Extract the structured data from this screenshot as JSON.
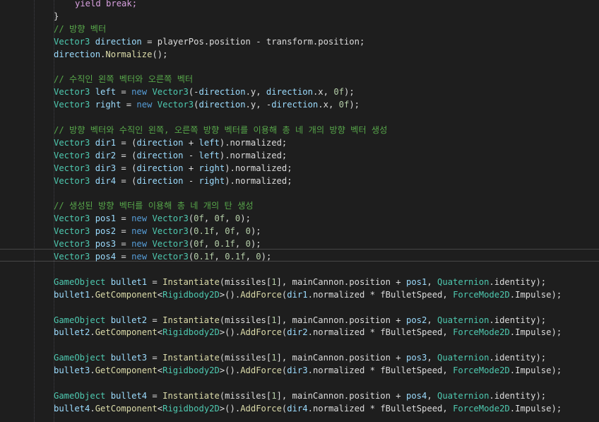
{
  "code_lines": [
    [
      {
        "t": "yield break;",
        "c": "ctl"
      }
    ],
    [
      {
        "t": "}",
        "c": "pl"
      }
    ],
    [
      {
        "t": "// 방향 벡터",
        "c": "cm"
      }
    ],
    [
      {
        "t": "Vector3",
        "c": "ty"
      },
      {
        "t": " ",
        "c": "pl"
      },
      {
        "t": "direction",
        "c": "lv"
      },
      {
        "t": " = playerPos.position - transform.position;",
        "c": "pl"
      }
    ],
    [
      {
        "t": "direction",
        "c": "lv"
      },
      {
        "t": ".",
        "c": "pl"
      },
      {
        "t": "Normalize",
        "c": "fn"
      },
      {
        "t": "();",
        "c": "pl"
      }
    ],
    [],
    [
      {
        "t": "// 수직인 왼쪽 벡터와 오른쪽 벡터",
        "c": "cm"
      }
    ],
    [
      {
        "t": "Vector3",
        "c": "ty"
      },
      {
        "t": " ",
        "c": "pl"
      },
      {
        "t": "left",
        "c": "lv"
      },
      {
        "t": " = ",
        "c": "pl"
      },
      {
        "t": "new",
        "c": "kw"
      },
      {
        "t": " ",
        "c": "pl"
      },
      {
        "t": "Vector3",
        "c": "ty"
      },
      {
        "t": "(-",
        "c": "pl"
      },
      {
        "t": "direction",
        "c": "lv"
      },
      {
        "t": ".y, ",
        "c": "pl"
      },
      {
        "t": "direction",
        "c": "lv"
      },
      {
        "t": ".x, ",
        "c": "pl"
      },
      {
        "t": "0f",
        "c": "num"
      },
      {
        "t": ");",
        "c": "pl"
      }
    ],
    [
      {
        "t": "Vector3",
        "c": "ty"
      },
      {
        "t": " ",
        "c": "pl"
      },
      {
        "t": "right",
        "c": "lv"
      },
      {
        "t": " = ",
        "c": "pl"
      },
      {
        "t": "new",
        "c": "kw"
      },
      {
        "t": " ",
        "c": "pl"
      },
      {
        "t": "Vector3",
        "c": "ty"
      },
      {
        "t": "(",
        "c": "pl"
      },
      {
        "t": "direction",
        "c": "lv"
      },
      {
        "t": ".y, -",
        "c": "pl"
      },
      {
        "t": "direction",
        "c": "lv"
      },
      {
        "t": ".x, ",
        "c": "pl"
      },
      {
        "t": "0f",
        "c": "num"
      },
      {
        "t": ");",
        "c": "pl"
      }
    ],
    [],
    [
      {
        "t": "// 방향 벡터와 수직인 왼쪽, 오른쪽 방향 벡터를 이용해 총 네 개의 방향 벡터 생성",
        "c": "cm"
      }
    ],
    [
      {
        "t": "Vector3",
        "c": "ty"
      },
      {
        "t": " ",
        "c": "pl"
      },
      {
        "t": "dir1",
        "c": "lv"
      },
      {
        "t": " = (",
        "c": "pl"
      },
      {
        "t": "direction",
        "c": "lv"
      },
      {
        "t": " + ",
        "c": "pl"
      },
      {
        "t": "left",
        "c": "lv"
      },
      {
        "t": ").normalized;",
        "c": "pl"
      }
    ],
    [
      {
        "t": "Vector3",
        "c": "ty"
      },
      {
        "t": " ",
        "c": "pl"
      },
      {
        "t": "dir2",
        "c": "lv"
      },
      {
        "t": " = (",
        "c": "pl"
      },
      {
        "t": "direction",
        "c": "lv"
      },
      {
        "t": " - ",
        "c": "pl"
      },
      {
        "t": "left",
        "c": "lv"
      },
      {
        "t": ").normalized;",
        "c": "pl"
      }
    ],
    [
      {
        "t": "Vector3",
        "c": "ty"
      },
      {
        "t": " ",
        "c": "pl"
      },
      {
        "t": "dir3",
        "c": "lv"
      },
      {
        "t": " = (",
        "c": "pl"
      },
      {
        "t": "direction",
        "c": "lv"
      },
      {
        "t": " + ",
        "c": "pl"
      },
      {
        "t": "right",
        "c": "lv"
      },
      {
        "t": ").normalized;",
        "c": "pl"
      }
    ],
    [
      {
        "t": "Vector3",
        "c": "ty"
      },
      {
        "t": " ",
        "c": "pl"
      },
      {
        "t": "dir4",
        "c": "lv"
      },
      {
        "t": " = (",
        "c": "pl"
      },
      {
        "t": "direction",
        "c": "lv"
      },
      {
        "t": " - ",
        "c": "pl"
      },
      {
        "t": "right",
        "c": "lv"
      },
      {
        "t": ").normalized;",
        "c": "pl"
      }
    ],
    [],
    [
      {
        "t": "// 생성된 방향 벡터를 이용해 총 네 개의 탄 생성",
        "c": "cm"
      }
    ],
    [
      {
        "t": "Vector3",
        "c": "ty"
      },
      {
        "t": " ",
        "c": "pl"
      },
      {
        "t": "pos1",
        "c": "lv"
      },
      {
        "t": " = ",
        "c": "pl"
      },
      {
        "t": "new",
        "c": "kw"
      },
      {
        "t": " ",
        "c": "pl"
      },
      {
        "t": "Vector3",
        "c": "ty"
      },
      {
        "t": "(",
        "c": "pl"
      },
      {
        "t": "0f",
        "c": "num"
      },
      {
        "t": ", ",
        "c": "pl"
      },
      {
        "t": "0f",
        "c": "num"
      },
      {
        "t": ", ",
        "c": "pl"
      },
      {
        "t": "0",
        "c": "num"
      },
      {
        "t": ");",
        "c": "pl"
      }
    ],
    [
      {
        "t": "Vector3",
        "c": "ty"
      },
      {
        "t": " ",
        "c": "pl"
      },
      {
        "t": "pos2",
        "c": "lv"
      },
      {
        "t": " = ",
        "c": "pl"
      },
      {
        "t": "new",
        "c": "kw"
      },
      {
        "t": " ",
        "c": "pl"
      },
      {
        "t": "Vector3",
        "c": "ty"
      },
      {
        "t": "(",
        "c": "pl"
      },
      {
        "t": "0.1f",
        "c": "num"
      },
      {
        "t": ", ",
        "c": "pl"
      },
      {
        "t": "0f",
        "c": "num"
      },
      {
        "t": ", ",
        "c": "pl"
      },
      {
        "t": "0",
        "c": "num"
      },
      {
        "t": ");",
        "c": "pl"
      }
    ],
    [
      {
        "t": "Vector3",
        "c": "ty"
      },
      {
        "t": " ",
        "c": "pl"
      },
      {
        "t": "pos3",
        "c": "lv"
      },
      {
        "t": " = ",
        "c": "pl"
      },
      {
        "t": "new",
        "c": "kw"
      },
      {
        "t": " ",
        "c": "pl"
      },
      {
        "t": "Vector3",
        "c": "ty"
      },
      {
        "t": "(",
        "c": "pl"
      },
      {
        "t": "0f",
        "c": "num"
      },
      {
        "t": ", ",
        "c": "pl"
      },
      {
        "t": "0.1f",
        "c": "num"
      },
      {
        "t": ", ",
        "c": "pl"
      },
      {
        "t": "0",
        "c": "num"
      },
      {
        "t": ");",
        "c": "pl"
      }
    ],
    [
      {
        "t": "Vector3",
        "c": "ty"
      },
      {
        "t": " ",
        "c": "pl"
      },
      {
        "t": "pos4",
        "c": "lv"
      },
      {
        "t": " = ",
        "c": "pl"
      },
      {
        "t": "new",
        "c": "kw"
      },
      {
        "t": " ",
        "c": "pl"
      },
      {
        "t": "Vector3",
        "c": "ty"
      },
      {
        "t": "(",
        "c": "pl"
      },
      {
        "t": "0.1f",
        "c": "num"
      },
      {
        "t": ", ",
        "c": "pl"
      },
      {
        "t": "0.1f",
        "c": "num"
      },
      {
        "t": ", ",
        "c": "pl"
      },
      {
        "t": "0",
        "c": "num"
      },
      {
        "t": ");",
        "c": "pl"
      }
    ],
    [],
    [
      {
        "t": "GameObject",
        "c": "ty"
      },
      {
        "t": " ",
        "c": "pl"
      },
      {
        "t": "bullet1",
        "c": "lv"
      },
      {
        "t": " = ",
        "c": "pl"
      },
      {
        "t": "Instantiate",
        "c": "fn"
      },
      {
        "t": "(missiles[",
        "c": "pl"
      },
      {
        "t": "1",
        "c": "num"
      },
      {
        "t": "], mainCannon.position + ",
        "c": "pl"
      },
      {
        "t": "pos1",
        "c": "lv"
      },
      {
        "t": ", ",
        "c": "pl"
      },
      {
        "t": "Quaternion",
        "c": "ty"
      },
      {
        "t": ".identity);",
        "c": "pl"
      }
    ],
    [
      {
        "t": "bullet1",
        "c": "lv"
      },
      {
        "t": ".",
        "c": "pl"
      },
      {
        "t": "GetComponent",
        "c": "fn"
      },
      {
        "t": "<",
        "c": "pl"
      },
      {
        "t": "Rigidbody2D",
        "c": "ty"
      },
      {
        "t": ">().",
        "c": "pl"
      },
      {
        "t": "AddForce",
        "c": "fn"
      },
      {
        "t": "(",
        "c": "pl"
      },
      {
        "t": "dir1",
        "c": "lv"
      },
      {
        "t": ".normalized * fBulletSpeed, ",
        "c": "pl"
      },
      {
        "t": "ForceMode2D",
        "c": "ty"
      },
      {
        "t": ".Impulse);",
        "c": "pl"
      }
    ],
    [],
    [
      {
        "t": "GameObject",
        "c": "ty"
      },
      {
        "t": " ",
        "c": "pl"
      },
      {
        "t": "bullet2",
        "c": "lv"
      },
      {
        "t": " = ",
        "c": "pl"
      },
      {
        "t": "Instantiate",
        "c": "fn"
      },
      {
        "t": "(missiles[",
        "c": "pl"
      },
      {
        "t": "1",
        "c": "num"
      },
      {
        "t": "], mainCannon.position + ",
        "c": "pl"
      },
      {
        "t": "pos2",
        "c": "lv"
      },
      {
        "t": ", ",
        "c": "pl"
      },
      {
        "t": "Quaternion",
        "c": "ty"
      },
      {
        "t": ".identity);",
        "c": "pl"
      }
    ],
    [
      {
        "t": "bullet2",
        "c": "lv"
      },
      {
        "t": ".",
        "c": "pl"
      },
      {
        "t": "GetComponent",
        "c": "fn"
      },
      {
        "t": "<",
        "c": "pl"
      },
      {
        "t": "Rigidbody2D",
        "c": "ty"
      },
      {
        "t": ">().",
        "c": "pl"
      },
      {
        "t": "AddForce",
        "c": "fn"
      },
      {
        "t": "(",
        "c": "pl"
      },
      {
        "t": "dir2",
        "c": "lv"
      },
      {
        "t": ".normalized * fBulletSpeed, ",
        "c": "pl"
      },
      {
        "t": "ForceMode2D",
        "c": "ty"
      },
      {
        "t": ".Impulse);",
        "c": "pl"
      }
    ],
    [],
    [
      {
        "t": "GameObject",
        "c": "ty"
      },
      {
        "t": " ",
        "c": "pl"
      },
      {
        "t": "bullet3",
        "c": "lv"
      },
      {
        "t": " = ",
        "c": "pl"
      },
      {
        "t": "Instantiate",
        "c": "fn"
      },
      {
        "t": "(missiles[",
        "c": "pl"
      },
      {
        "t": "1",
        "c": "num"
      },
      {
        "t": "], mainCannon.position + ",
        "c": "pl"
      },
      {
        "t": "pos3",
        "c": "lv"
      },
      {
        "t": ", ",
        "c": "pl"
      },
      {
        "t": "Quaternion",
        "c": "ty"
      },
      {
        "t": ".identity);",
        "c": "pl"
      }
    ],
    [
      {
        "t": "bullet3",
        "c": "lv"
      },
      {
        "t": ".",
        "c": "pl"
      },
      {
        "t": "GetComponent",
        "c": "fn"
      },
      {
        "t": "<",
        "c": "pl"
      },
      {
        "t": "Rigidbody2D",
        "c": "ty"
      },
      {
        "t": ">().",
        "c": "pl"
      },
      {
        "t": "AddForce",
        "c": "fn"
      },
      {
        "t": "(",
        "c": "pl"
      },
      {
        "t": "dir3",
        "c": "lv"
      },
      {
        "t": ".normalized * fBulletSpeed, ",
        "c": "pl"
      },
      {
        "t": "ForceMode2D",
        "c": "ty"
      },
      {
        "t": ".Impulse);",
        "c": "pl"
      }
    ],
    [],
    [
      {
        "t": "GameObject",
        "c": "ty"
      },
      {
        "t": " ",
        "c": "pl"
      },
      {
        "t": "bullet4",
        "c": "lv"
      },
      {
        "t": " = ",
        "c": "pl"
      },
      {
        "t": "Instantiate",
        "c": "fn"
      },
      {
        "t": "(missiles[",
        "c": "pl"
      },
      {
        "t": "1",
        "c": "num"
      },
      {
        "t": "], mainCannon.position + ",
        "c": "pl"
      },
      {
        "t": "pos4",
        "c": "lv"
      },
      {
        "t": ", ",
        "c": "pl"
      },
      {
        "t": "Quaternion",
        "c": "ty"
      },
      {
        "t": ".identity);",
        "c": "pl"
      }
    ],
    [
      {
        "t": "bullet4",
        "c": "lv"
      },
      {
        "t": ".",
        "c": "pl"
      },
      {
        "t": "GetComponent",
        "c": "fn"
      },
      {
        "t": "<",
        "c": "pl"
      },
      {
        "t": "Rigidbody2D",
        "c": "ty"
      },
      {
        "t": ">().",
        "c": "pl"
      },
      {
        "t": "AddForce",
        "c": "fn"
      },
      {
        "t": "(",
        "c": "pl"
      },
      {
        "t": "dir4",
        "c": "lv"
      },
      {
        "t": ".normalized * fBulletSpeed, ",
        "c": "pl"
      },
      {
        "t": "ForceMode2D",
        "c": "ty"
      },
      {
        "t": ".Impulse);",
        "c": "pl"
      }
    ]
  ],
  "current_line_index": 20,
  "indented_line_indices": [
    0
  ],
  "colors": {
    "background": "#1e1e1e",
    "comment": "#57a64a",
    "keyword": "#569cd6",
    "control_keyword": "#d8a0df",
    "type": "#4ec9b0",
    "method": "#dcdcaa",
    "local": "#9cdcfe",
    "number": "#b5cea8",
    "plain": "#dcdcdc"
  }
}
